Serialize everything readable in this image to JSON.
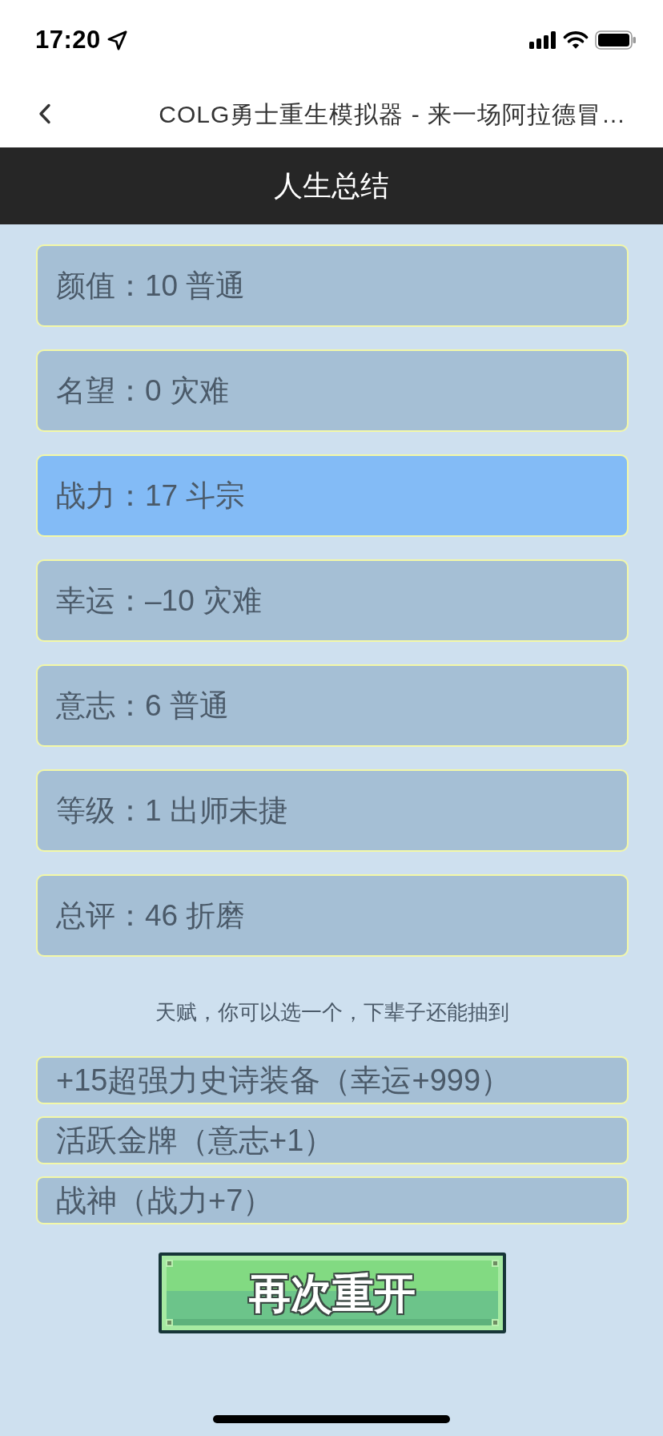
{
  "status_bar": {
    "time": "17:20"
  },
  "nav_bar": {
    "title": "COLG勇士重生模拟器 - 来一场阿拉德冒…"
  },
  "header": {
    "title": "人生总结"
  },
  "summary": [
    {
      "text": "颜值：10 普通",
      "highlighted": false
    },
    {
      "text": "名望：0 灾难",
      "highlighted": false
    },
    {
      "text": "战力：17 斗宗",
      "highlighted": true
    },
    {
      "text": "幸运：–10 灾难",
      "highlighted": false
    },
    {
      "text": "意志：6 普通",
      "highlighted": false
    },
    {
      "text": "等级：1 出师未捷",
      "highlighted": false
    },
    {
      "text": "总评：46 折磨",
      "highlighted": false
    }
  ],
  "talent_hint": "天赋，你可以选一个，下辈子还能抽到",
  "talents": [
    {
      "text": "+15超强力史诗装备（幸运+999）",
      "selected": false
    },
    {
      "text": "活跃金牌（意志+1）",
      "selected": false
    },
    {
      "text": "战神（战力+7）",
      "selected": false
    }
  ],
  "restart_button": {
    "label": "再次重开"
  }
}
